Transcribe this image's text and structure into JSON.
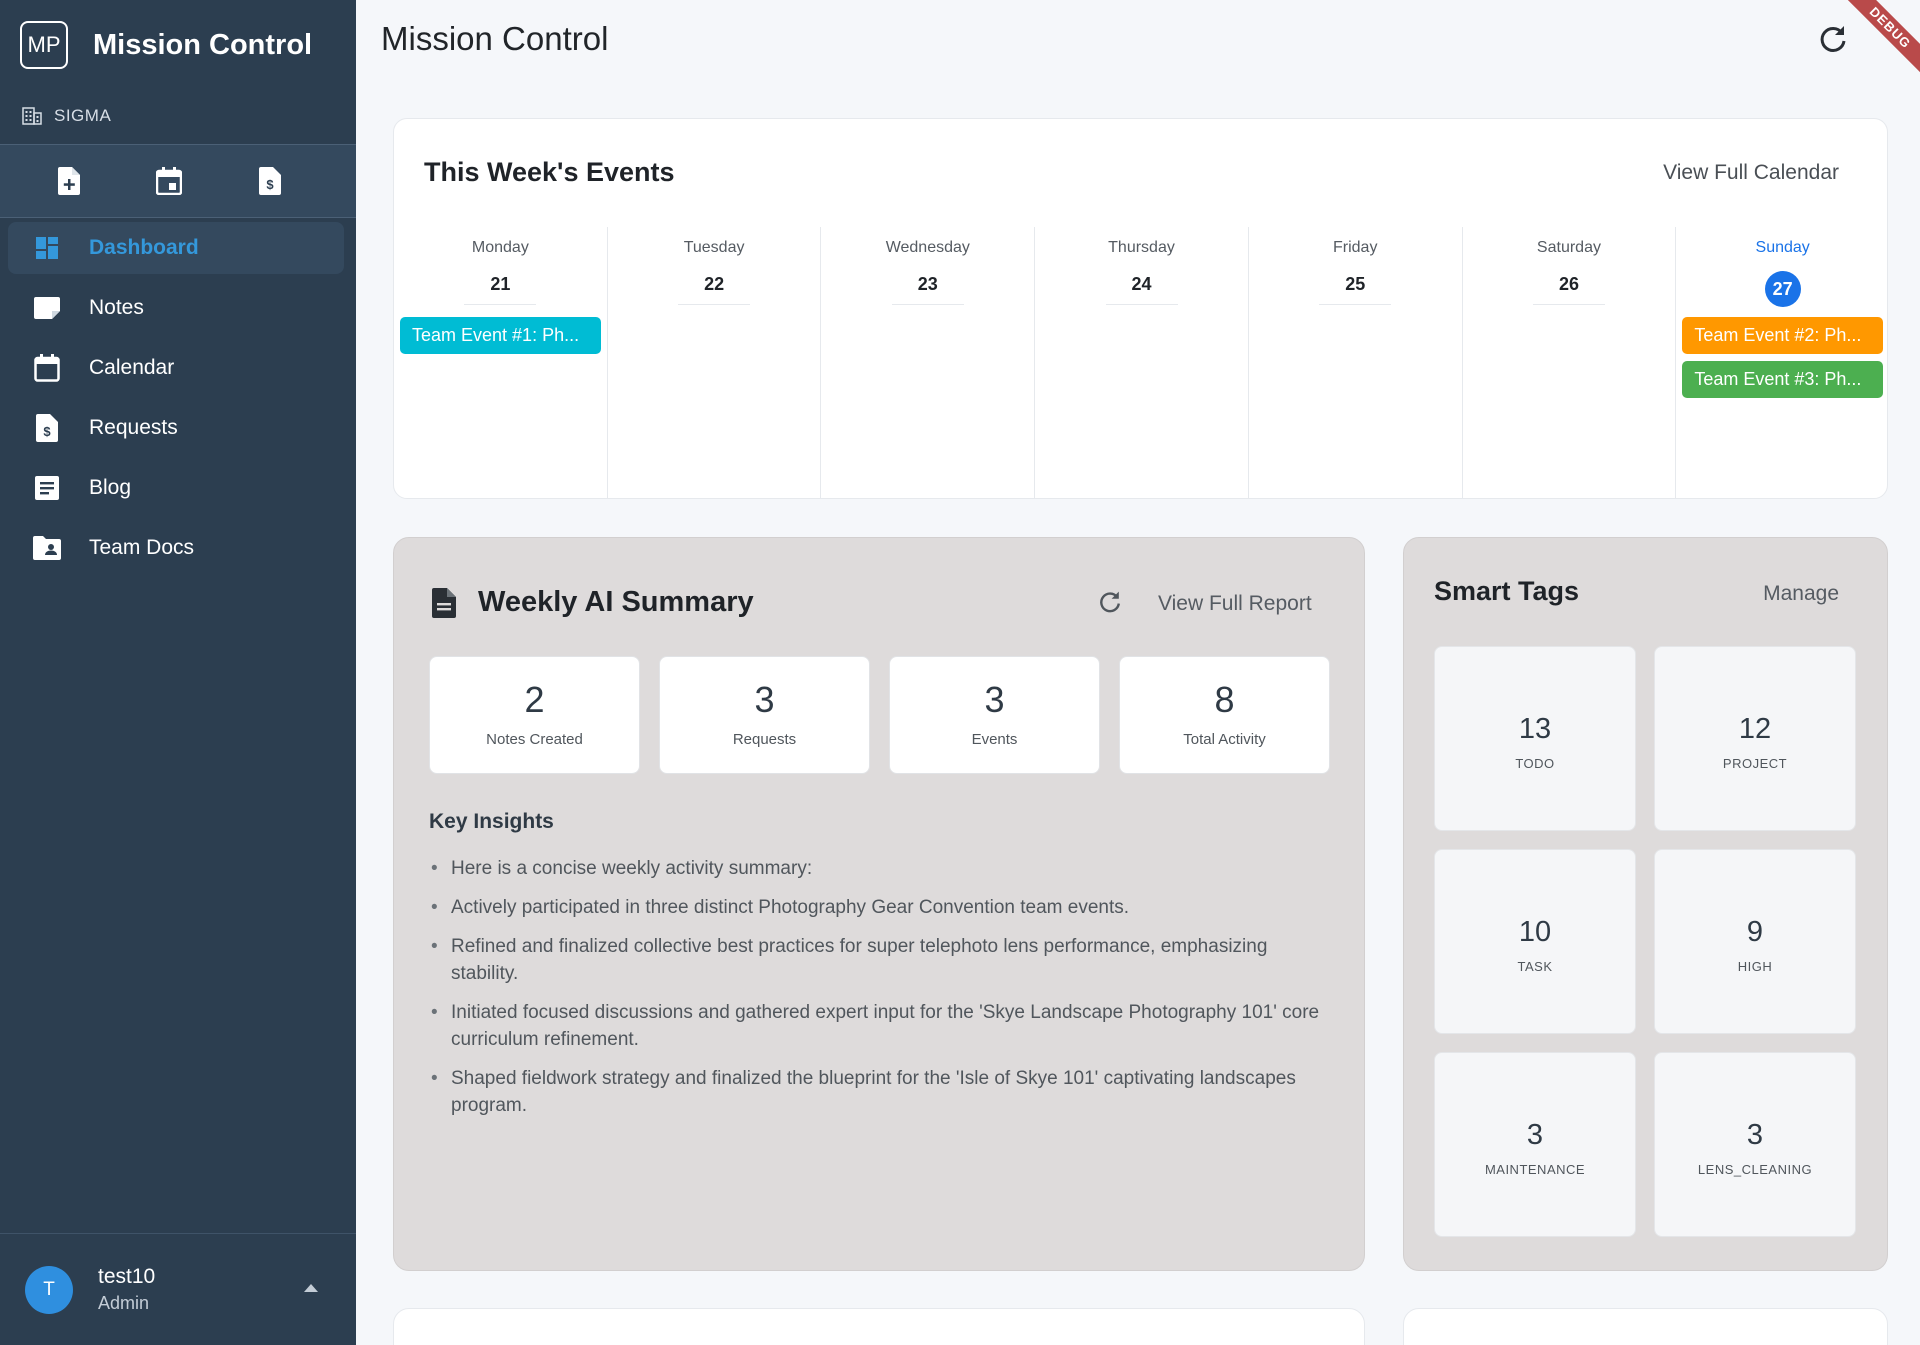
{
  "sidebar": {
    "logo": "MP",
    "app_title": "Mission Control",
    "org": "SIGMA",
    "quick_actions": [
      {
        "icon": "note-add-icon"
      },
      {
        "icon": "calendar-event-icon"
      },
      {
        "icon": "request-invoice-icon"
      }
    ],
    "nav": [
      {
        "label": "Dashboard",
        "icon": "dashboard-icon",
        "active": true
      },
      {
        "label": "Notes",
        "icon": "note-icon"
      },
      {
        "label": "Calendar",
        "icon": "calendar-icon"
      },
      {
        "label": "Requests",
        "icon": "request-icon"
      },
      {
        "label": "Blog",
        "icon": "article-icon"
      },
      {
        "label": "Team Docs",
        "icon": "folder-shared-icon"
      }
    ],
    "user": {
      "initial": "T",
      "name": "test10",
      "role": "Admin"
    }
  },
  "header": {
    "title": "Mission Control",
    "debug_banner": "DEBUG"
  },
  "events": {
    "title": "This Week's Events",
    "link": "View Full Calendar",
    "days": [
      {
        "name": "Monday",
        "date": "21",
        "events": [
          {
            "label": "Team Event #1: Ph...",
            "color": "#00bcd4"
          }
        ]
      },
      {
        "name": "Tuesday",
        "date": "22",
        "events": []
      },
      {
        "name": "Wednesday",
        "date": "23",
        "events": []
      },
      {
        "name": "Thursday",
        "date": "24",
        "events": []
      },
      {
        "name": "Friday",
        "date": "25",
        "events": []
      },
      {
        "name": "Saturday",
        "date": "26",
        "events": []
      },
      {
        "name": "Sunday",
        "date": "27",
        "today": true,
        "events": [
          {
            "label": "Team Event #2: Ph...",
            "color": "#ff9800"
          },
          {
            "label": "Team Event #3: Ph...",
            "color": "#4caf50"
          }
        ]
      }
    ]
  },
  "ai_summary": {
    "title": "Weekly AI Summary",
    "link": "View Full Report",
    "stats": [
      {
        "value": "2",
        "label": "Notes Created"
      },
      {
        "value": "3",
        "label": "Requests"
      },
      {
        "value": "3",
        "label": "Events"
      },
      {
        "value": "8",
        "label": "Total Activity"
      }
    ],
    "insights_title": "Key Insights",
    "insights": [
      "Here is a concise weekly activity summary:",
      "Actively participated in three distinct Photography Gear Convention team events.",
      "Refined and finalized collective best practices for super telephoto lens performance, emphasizing stability.",
      "Initiated focused discussions and gathered expert input for the 'Skye Landscape Photography 101' core curriculum refinement.",
      "Shaped fieldwork strategy and finalized the blueprint for the 'Isle of Skye 101' captivating landscapes program."
    ]
  },
  "smart_tags": {
    "title": "Smart Tags",
    "link": "Manage",
    "tags": [
      {
        "count": "13",
        "name": "TODO"
      },
      {
        "count": "12",
        "name": "PROJECT"
      },
      {
        "count": "10",
        "name": "TASK"
      },
      {
        "count": "9",
        "name": "HIGH"
      },
      {
        "count": "3",
        "name": "MAINTENANCE"
      },
      {
        "count": "3",
        "name": "LENS_CLEANING"
      }
    ]
  },
  "colors": {
    "sidebar_bg": "#2c3e50",
    "accent": "#3498db",
    "today": "#1a73e8"
  }
}
